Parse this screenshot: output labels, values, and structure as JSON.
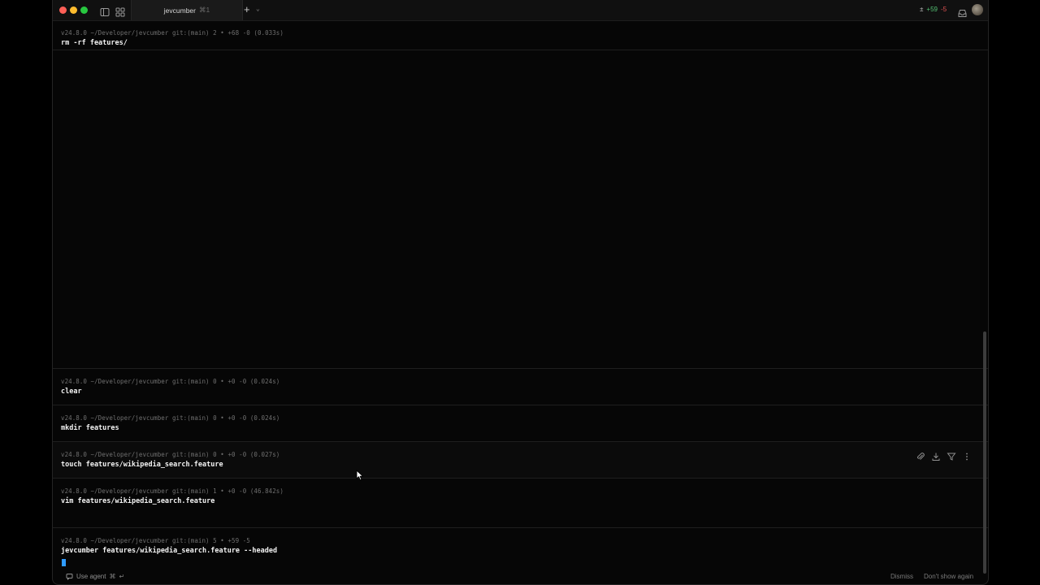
{
  "titlebar": {
    "tab_title": "jevcumber",
    "tab_shortcut": "⌘1",
    "new_tab_symbol": "+",
    "new_tab_menu_symbol": "⌄",
    "git_status": {
      "prefix": "±",
      "added": "+59",
      "removed": "-5"
    }
  },
  "blocks": [
    {
      "meta": "v24.8.0 ~/Developer/jevcumber git:(main) 2 • +68 -0 (0.033s)",
      "command": "rm -rf features/"
    },
    {
      "meta": "v24.8.0 ~/Developer/jevcumber git:(main) 0 • +0 -0 (0.024s)",
      "command": "clear"
    },
    {
      "meta": "v24.8.0 ~/Developer/jevcumber git:(main) 0 • +0 -0 (0.024s)",
      "command": "mkdir features"
    },
    {
      "meta": "v24.8.0 ~/Developer/jevcumber git:(main) 0 • +0 -0 (0.027s)",
      "command": "touch features/wikipedia_search.feature"
    },
    {
      "meta": "v24.8.0 ~/Developer/jevcumber git:(main) 1 • +0 -0 (46.842s)",
      "command": "vim features/wikipedia_search.feature"
    },
    {
      "meta": "v24.8.0 ~/Developer/jevcumber git:(main) 5 • +59 -5",
      "command": "jevcumber features/wikipedia_search.feature --headed"
    }
  ],
  "footer": {
    "use_agent": "Use agent",
    "shortcut_cmd": "⌘",
    "shortcut_enter": "↵",
    "dismiss": "Dismiss",
    "dont_show_again": "Don't show again"
  },
  "colors": {
    "background": "#060606",
    "cursor": "#2f9bff",
    "git_added": "#53c173",
    "git_removed": "#e05252"
  }
}
